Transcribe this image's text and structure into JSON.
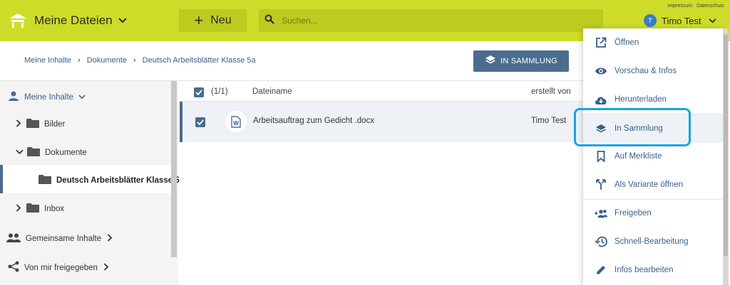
{
  "header": {
    "app_title": "Meine Dateien",
    "new_label": "Neu",
    "search_placeholder": "Suchen...",
    "links": [
      "Impressum",
      "Datenschutz"
    ],
    "user_initial": "T",
    "user_name": "Timo Test"
  },
  "breadcrumb": {
    "items": [
      "Meine Inhalte",
      "Dokumente",
      "Deutsch Arbeitsblätter Klasse 5a"
    ],
    "collection_button": "IN SAMMLUNG"
  },
  "sidebar": {
    "my_content": "Meine Inhalte",
    "folders": [
      "Bilder",
      "Dokumente",
      "Deutsch Arbeitsblätter Klasse 5",
      "Inbox"
    ],
    "shared": "Gemeinsame Inhalte",
    "shared_by_me": "Von mir freigegeben"
  },
  "list": {
    "selection_count": "(1/1)",
    "col_name": "Dateiname",
    "col_creator": "erstellt von",
    "rows": [
      {
        "name": "Arbeitsauftrag zum Gedicht .docx",
        "creator": "Timo Test"
      }
    ]
  },
  "menu": {
    "items": [
      {
        "label": "Öffnen",
        "icon": "open-external-icon"
      },
      {
        "label": "Vorschau & Infos",
        "icon": "eye-icon"
      },
      {
        "label": "Herunterladen",
        "icon": "cloud-download-icon"
      },
      {
        "label": "In Sammlung",
        "icon": "layers-icon"
      },
      {
        "label": "Auf Merkliste",
        "icon": "bookmark-icon"
      },
      {
        "label": "Als Variante öffnen",
        "icon": "fork-icon"
      },
      {
        "label": "Freigeben",
        "icon": "share-people-icon"
      },
      {
        "label": "Schnell-Bearbeitung",
        "icon": "history-icon"
      },
      {
        "label": "Infos bearbeiten",
        "icon": "pencil-icon"
      }
    ]
  },
  "colors": {
    "header": "#cddc28",
    "header_controls": "#bccb1e",
    "primary": "#4a6d8e",
    "link": "#3a5f8a",
    "focus_ring": "#19a3e0"
  }
}
